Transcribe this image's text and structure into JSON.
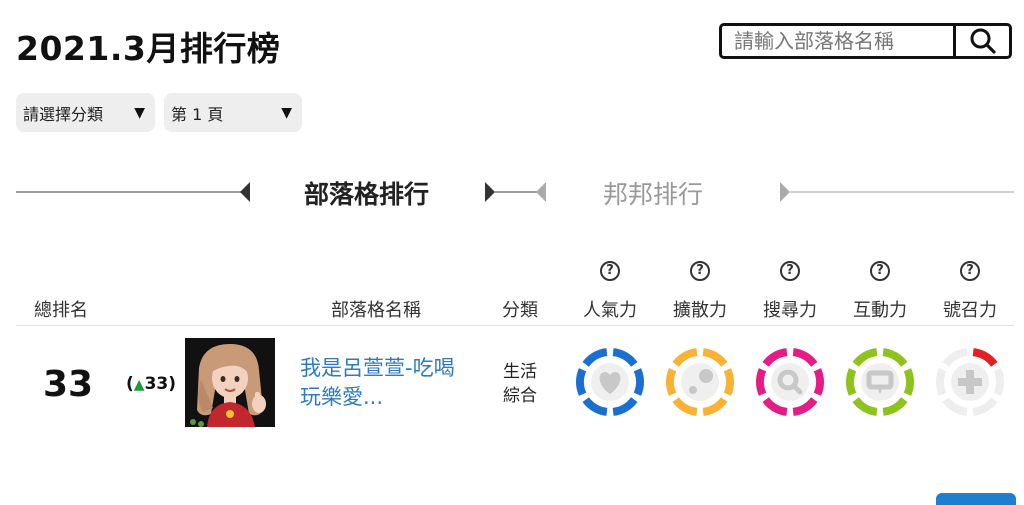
{
  "header": {
    "title": "2021.3月排行榜"
  },
  "search": {
    "placeholder": "請輸入部落格名稱"
  },
  "filters": {
    "category_label": "請選擇分類",
    "page_label": "第 1 頁"
  },
  "tabs": [
    {
      "label": "部落格排行",
      "active": true
    },
    {
      "label": "邦邦排行",
      "active": false
    }
  ],
  "table": {
    "help_mark": "?",
    "headers": {
      "rank": "總排名",
      "blog_name": "部落格名稱",
      "category": "分類",
      "popularity": "人氣力",
      "spread": "擴散力",
      "search": "搜尋力",
      "interaction": "互動力",
      "appeal": "號召力"
    },
    "rows": [
      {
        "rank": "33",
        "change_open": "(",
        "change_arrow": "▲",
        "change_value": "33",
        "change_close": ")",
        "blog_name": "我是呂萱萱-吃喝玩樂愛...",
        "category_line1": "生活",
        "category_line2": "綜合",
        "scores": {
          "popularity": {
            "color": "#1b6fd0",
            "level": 1.0,
            "icon": "heart-icon"
          },
          "spread": {
            "color": "#f9b233",
            "level": 1.0,
            "icon": "share-icon"
          },
          "search": {
            "color": "#e41c85",
            "level": 1.0,
            "icon": "magnifier-icon"
          },
          "interaction": {
            "color": "#8ec31e",
            "level": 1.0,
            "icon": "chat-icon"
          },
          "appeal": {
            "color": "#e31e24",
            "level": 0.17,
            "icon": "plus-icon"
          }
        }
      }
    ]
  },
  "colors": {
    "link": "#2e7bbe",
    "rank_up": "#1a9a3a",
    "track": "#eeeeee"
  }
}
